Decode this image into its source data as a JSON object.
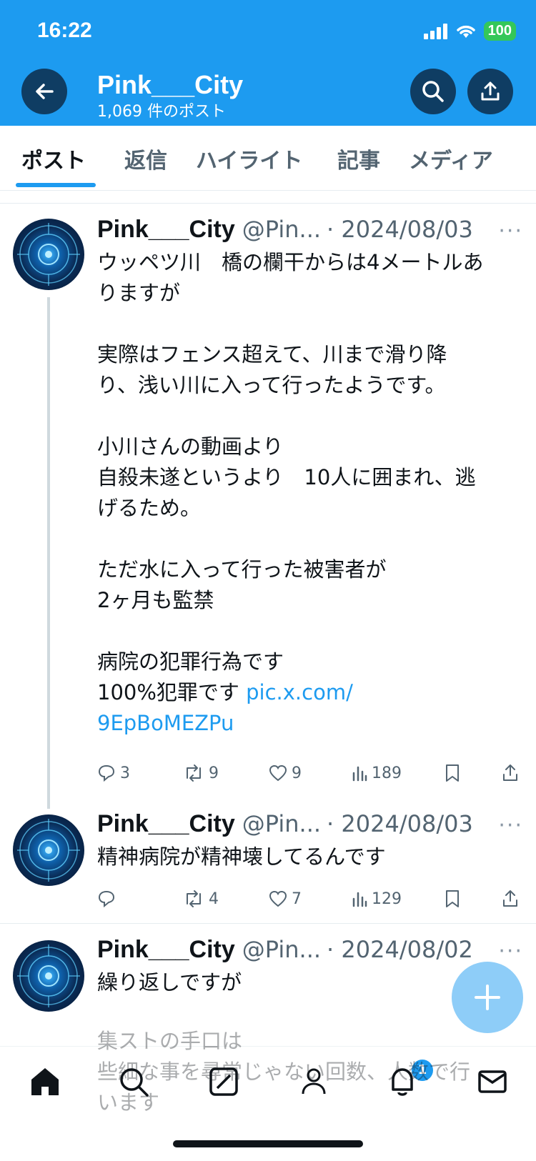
{
  "status": {
    "time": "16:22",
    "battery": "100"
  },
  "header": {
    "title": "Pink___City",
    "post_count": "1,069 件のポスト"
  },
  "tabs": [
    {
      "label": "ポスト"
    },
    {
      "label": "返信"
    },
    {
      "label": "ハイライト"
    },
    {
      "label": "記事"
    },
    {
      "label": "メディア"
    }
  ],
  "posts": [
    {
      "name": "Pink___City",
      "handle": "@Pin...",
      "date": "· 2024/08/03",
      "lines": [
        "ウッペツ川　橋の欄干からは4メートルあ",
        "りますが",
        "",
        "実際はフェンス超えて、川まで滑り降",
        "り、浅い川に入って行ったようです。",
        "",
        "小川さんの動画より",
        "自殺未遂というより　10人に囲まれ、逃",
        "げるため。",
        "",
        "ただ水に入って行った被害者が",
        "2ヶ月も監禁",
        "",
        "病院の犯罪行為です"
      ],
      "last_line_text": "100%犯罪です ",
      "link_part1": "pic.x.com/",
      "link_part2": "9EpBoMEZPu",
      "replies": "3",
      "reposts": "9",
      "likes": "9",
      "views": "189"
    },
    {
      "name": "Pink___City",
      "handle": "@Pin...",
      "date": "· 2024/08/03",
      "text": "精神病院が精神壊してるんです",
      "replies": "",
      "reposts": "4",
      "likes": "7",
      "views": "129"
    },
    {
      "name": "Pink___City",
      "handle": "@Pin...",
      "date": "· 2024/08/02",
      "text": "繰り返しですが",
      "overlay_lines": [
        "集ストの手口は",
        "些細な事を尋常じゃない回数、人数で行",
        "います"
      ]
    }
  ],
  "bottom_nav": {
    "notification_count": "1"
  }
}
